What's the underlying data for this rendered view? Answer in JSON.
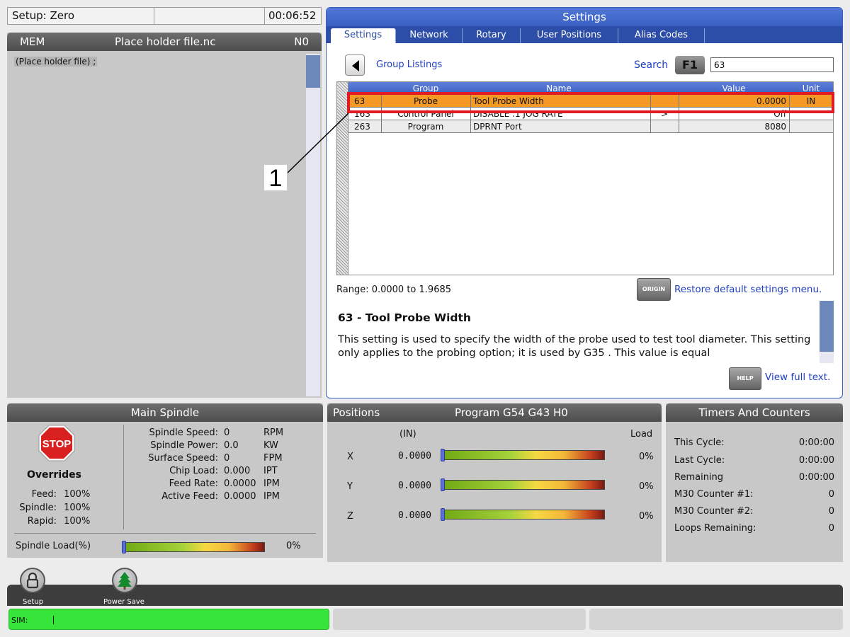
{
  "setup_bar": {
    "title": "Setup: Zero",
    "time": "00:06:52"
  },
  "program": {
    "mode": "MEM",
    "file": "Place holder file.nc",
    "line_number": "N0",
    "code_line": "(Place holder file) ;"
  },
  "settings": {
    "title": "Settings",
    "tabs": [
      "Settings",
      "Network",
      "Rotary",
      "User Positions",
      "Alias Codes"
    ],
    "active_tab": "Settings",
    "group_listings": "Group Listings",
    "search_label": "Search",
    "search_key": "F1",
    "search_value": "63",
    "table": {
      "headers": [
        "Group",
        "Name",
        "Value",
        "Unit"
      ],
      "rows": [
        {
          "number": "63",
          "group": "Probe",
          "name": "Tool Probe Width",
          "arrow": "",
          "value": "0.0000",
          "unit": "IN"
        },
        {
          "number": "163",
          "group": "Control Panel",
          "name": "DISABLE .1 JOG RATE",
          "arrow": ">",
          "value": "Off",
          "unit": ""
        },
        {
          "number": "263",
          "group": "Program",
          "name": "DPRNT Port",
          "arrow": "",
          "value": "8080",
          "unit": ""
        }
      ]
    },
    "range": "Range: 0.0000 to 1.9685",
    "origin_key": "ORIGIN",
    "restore_text": "Restore default settings menu.",
    "description_title": "63 - Tool Probe Width",
    "description_text": "This setting is used to specify the width of the probe used to test tool diameter. This setting only applies to the probing option; it is used by G35 . This value is equal",
    "help_key": "HELP",
    "full_text_link": "View full text."
  },
  "callout": {
    "number": "1"
  },
  "spindle": {
    "title": "Main Spindle",
    "stop_label": "STOP",
    "overrides_label": "Overrides",
    "overrides": [
      {
        "label": "Feed:",
        "value": "100%"
      },
      {
        "label": "Spindle:",
        "value": "100%"
      },
      {
        "label": "Rapid:",
        "value": "100%"
      }
    ],
    "stats": [
      {
        "label": "Spindle Speed:",
        "value": "0",
        "unit": "RPM"
      },
      {
        "label": "Spindle Power:",
        "value": "0.0",
        "unit": "KW"
      },
      {
        "label": "Surface Speed:",
        "value": "0",
        "unit": "FPM"
      },
      {
        "label": "Chip Load:",
        "value": "0.000",
        "unit": "IPT"
      },
      {
        "label": "Feed Rate:",
        "value": "0.0000",
        "unit": "IPM"
      },
      {
        "label": "Active Feed:",
        "value": "0.0000",
        "unit": "IPM"
      }
    ],
    "load_label": "Spindle Load(%)",
    "load_value": "0%",
    "load_fraction": 0
  },
  "positions": {
    "title": "Positions",
    "subtitle": "Program G54 G43 H0",
    "units": "(IN)",
    "load_header": "Load",
    "axes": [
      {
        "axis": "X",
        "value": "0.0000",
        "load": "0%",
        "load_fraction": 0
      },
      {
        "axis": "Y",
        "value": "0.0000",
        "load": "0%",
        "load_fraction": 0
      },
      {
        "axis": "Z",
        "value": "0.0000",
        "load": "0%",
        "load_fraction": 0
      }
    ]
  },
  "timers": {
    "title": "Timers And Counters",
    "items": [
      {
        "label": "This Cycle:",
        "value": "0:00:00"
      },
      {
        "label": "Last Cycle:",
        "value": "0:00:00"
      },
      {
        "label": "Remaining",
        "value": "0:00:00"
      },
      {
        "label": "M30 Counter #1:",
        "value": "0"
      },
      {
        "label": "M30 Counter #2:",
        "value": "0"
      },
      {
        "label": "Loops Remaining:",
        "value": "0"
      }
    ]
  },
  "bottom": {
    "setup_label": "Setup",
    "power_save_label": "Power Save",
    "sim_label": "SIM:"
  },
  "colors": {
    "header_blue": "#3b60c4",
    "selected_row": "#f49a24",
    "highlight_red": "#e01b24",
    "sim_green": "#36e43a",
    "stop_red": "#d8201f"
  }
}
